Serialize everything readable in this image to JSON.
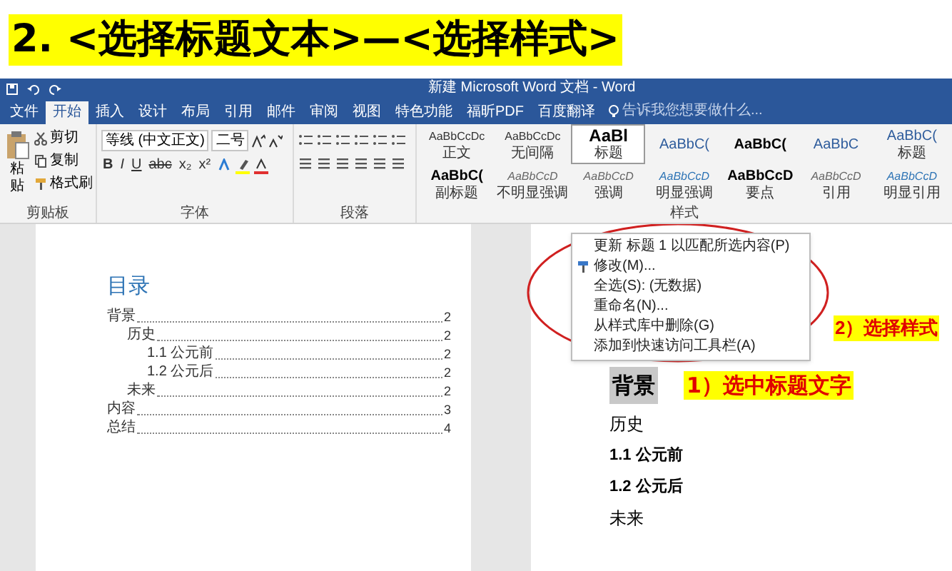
{
  "banner": {
    "title": "2. <选择标题文本>—<选择样式>"
  },
  "window": {
    "title": "新建 Microsoft Word 文档 - Word"
  },
  "tabs": [
    {
      "label": "文件",
      "selected": false
    },
    {
      "label": "开始",
      "selected": true
    },
    {
      "label": "插入",
      "selected": false
    },
    {
      "label": "设计",
      "selected": false
    },
    {
      "label": "布局",
      "selected": false
    },
    {
      "label": "引用",
      "selected": false
    },
    {
      "label": "邮件",
      "selected": false
    },
    {
      "label": "审阅",
      "selected": false
    },
    {
      "label": "视图",
      "selected": false
    },
    {
      "label": "特色功能",
      "selected": false
    },
    {
      "label": "福昕PDF",
      "selected": false
    },
    {
      "label": "百度翻译",
      "selected": false
    }
  ],
  "tell_me": {
    "placeholder": "告诉我您想要做什么..."
  },
  "clipboard": {
    "paste": "粘贴",
    "items": [
      "剪切",
      "复制",
      "格式刷"
    ],
    "group": "剪贴板"
  },
  "font": {
    "name": "等线 (中文正文)",
    "size": "二号",
    "format_buttons": [
      "B",
      "I",
      "U",
      "abc",
      "x₂",
      "x²"
    ],
    "group": "字体"
  },
  "paragraph": {
    "group": "段落"
  },
  "styles": {
    "group": "样式",
    "items": [
      {
        "sample": "AaBbCcDc",
        "label": "正文",
        "kind": "body",
        "selected": false
      },
      {
        "sample": "AaBbCcDc",
        "label": "无间隔",
        "kind": "body",
        "selected": false
      },
      {
        "sample": "AaBl",
        "label": "标题",
        "kind": "heading",
        "selected": true
      },
      {
        "sample": "AaBbC(",
        "kind": "heading2",
        "selected": false
      },
      {
        "sample": "AaBbC(",
        "kind": "strong",
        "selected": false
      },
      {
        "sample": "AaBbC",
        "kind": "heading2",
        "selected": false
      },
      {
        "sample": "AaBbC(",
        "label": "标题",
        "kind": "heading2",
        "selected": false
      },
      {
        "sample": "AaBbC(",
        "label": "副标题",
        "kind": "strong",
        "selected": false
      },
      {
        "sample": "AaBbCcD",
        "label": "不明显强调",
        "kind": "subtle",
        "selected": false
      },
      {
        "sample": "AaBbCcD",
        "label": "强调",
        "kind": "subtle",
        "selected": false
      },
      {
        "sample": "AaBbCcD",
        "label": "明显强调",
        "kind": "accent",
        "selected": false
      },
      {
        "sample": "AaBbCcD",
        "label": "要点",
        "kind": "strong",
        "selected": false
      },
      {
        "sample": "AaBbCcD",
        "label": "引用",
        "kind": "subtle",
        "selected": false
      },
      {
        "sample": "AaBbCcD",
        "label": "明显引用",
        "kind": "accent",
        "selected": false
      }
    ]
  },
  "context_menu": {
    "items": [
      {
        "label": "更新 标题 1 以匹配所选内容(P)",
        "kind": "plain"
      },
      {
        "label": "修改(M)...",
        "kind": "brush"
      },
      {
        "label": "全选(S): (无数据)",
        "kind": "plain"
      },
      {
        "label": "重命名(N)...",
        "kind": "plain"
      },
      {
        "label": "从样式库中删除(G)",
        "kind": "plain"
      },
      {
        "label": "添加到快速访问工具栏(A)",
        "kind": "plain"
      }
    ]
  },
  "toc": {
    "title": "目录",
    "entries": [
      {
        "text": "背景",
        "page": "2",
        "children": [
          {
            "text": "历史",
            "page": "2",
            "children": [
              {
                "text": "1.1 公元前",
                "page": "2"
              },
              {
                "text": "1.2 公元后",
                "page": "2"
              }
            ]
          },
          {
            "text": "未来",
            "page": "2"
          }
        ]
      },
      {
        "text": "内容",
        "page": "3"
      },
      {
        "text": "总结",
        "page": "4"
      }
    ]
  },
  "document": {
    "paragraphs": [
      {
        "text": "背景",
        "kind": "heading1",
        "selected": true
      },
      {
        "text": "历史",
        "kind": "body",
        "selected": false
      },
      {
        "text": "1.1 公元前",
        "kind": "heading3",
        "selected": false
      },
      {
        "text": "1.2  公元后",
        "kind": "heading3",
        "selected": false
      },
      {
        "text": "未来",
        "kind": "body",
        "selected": false
      }
    ]
  },
  "annotations": [
    {
      "text": "2）选择样式"
    },
    {
      "text": "1）选中标题文字"
    }
  ]
}
